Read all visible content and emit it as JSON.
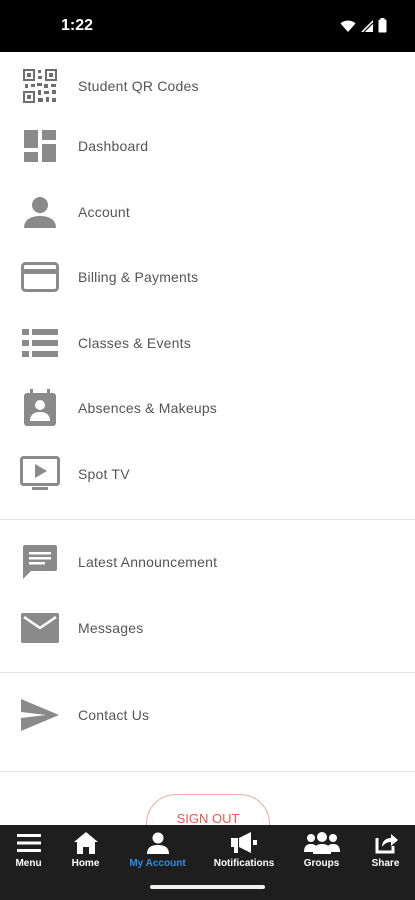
{
  "status": {
    "time": "1:22"
  },
  "menu": {
    "items": [
      {
        "label": "Student QR Codes",
        "icon": "qr-code-icon"
      },
      {
        "label": "Dashboard",
        "icon": "dashboard-icon"
      },
      {
        "label": "Account",
        "icon": "person-icon"
      },
      {
        "label": "Billing & Payments",
        "icon": "credit-card-icon"
      },
      {
        "label": "Classes & Events",
        "icon": "list-icon"
      },
      {
        "label": "Absences & Makeups",
        "icon": "attendance-icon"
      },
      {
        "label": "Spot TV",
        "icon": "tv-play-icon"
      },
      {
        "label": "Latest Announcement",
        "icon": "announcement-icon"
      },
      {
        "label": "Messages",
        "icon": "mail-icon"
      },
      {
        "label": "Contact Us",
        "icon": "send-icon"
      }
    ],
    "signout_label": "SIGN OUT"
  },
  "tabs": [
    {
      "label": "Menu",
      "icon": "hamburger-icon"
    },
    {
      "label": "Home",
      "icon": "home-icon"
    },
    {
      "label": "My Account",
      "icon": "person-icon",
      "active": true
    },
    {
      "label": "Notifications",
      "icon": "megaphone-icon"
    },
    {
      "label": "Groups",
      "icon": "group-icon"
    },
    {
      "label": "Share",
      "icon": "share-icon"
    }
  ],
  "colors": {
    "icon_gray": "#8a8a8a",
    "text_gray": "#555555",
    "active_tab": "#2f8dea",
    "signout_red": "#e8594f",
    "tab_bar_bg": "#1e1e1e"
  }
}
